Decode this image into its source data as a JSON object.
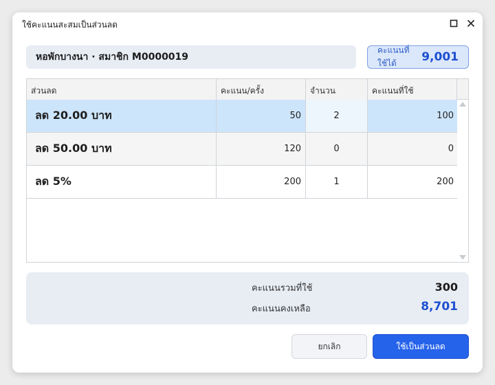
{
  "window": {
    "title": "ใช้คะแนนสะสมเป็นส่วนลด"
  },
  "member": {
    "label": "หอพักบางนา · สมาชิก M0000019"
  },
  "points": {
    "label": "คะแนนที่ใช้ได้",
    "value": "9,001"
  },
  "table": {
    "columns": [
      "ส่วนลด",
      "คะแนน/ครั้ง",
      "จำนวน",
      "คะแนนที่ใช้"
    ],
    "rows": [
      {
        "name": "ลด 20.00 บาท",
        "points": "50",
        "qty": "2",
        "used": "100"
      },
      {
        "name": "ลด 50.00 บาท",
        "points": "120",
        "qty": "0",
        "used": "0"
      },
      {
        "name": "ลด 5%",
        "points": "200",
        "qty": "1",
        "used": "200"
      }
    ]
  },
  "summary": {
    "total_label": "คะแนนรวมที่ใช้",
    "total_value": "300",
    "remain_label": "คะแนนคงเหลือ",
    "remain_value": "8,701"
  },
  "buttons": {
    "cancel": "ยกเลิก",
    "apply": "ใช้เป็นส่วนลด"
  },
  "colors": {
    "accent": "#2563eb",
    "selected_row": "#cde5fb"
  }
}
